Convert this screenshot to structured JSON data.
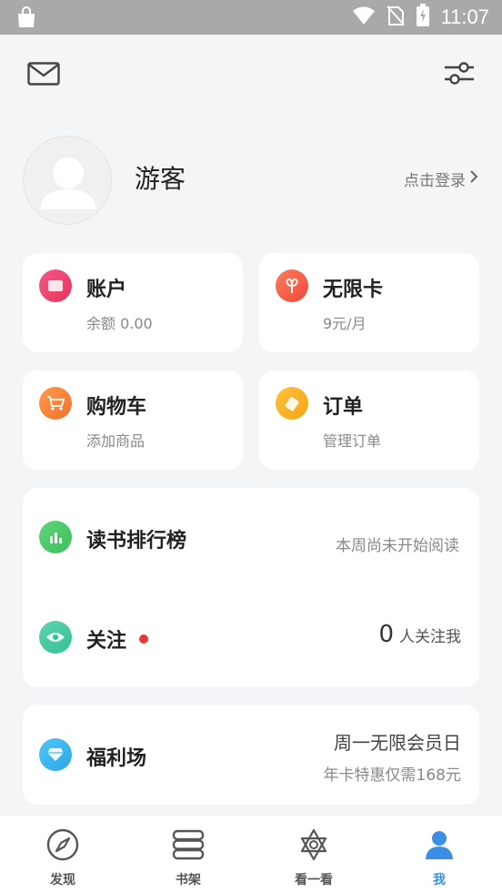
{
  "status_bar": {
    "time": "11:07"
  },
  "profile": {
    "username": "游客",
    "login_label": "点击登录"
  },
  "cards": {
    "account": {
      "title": "账户",
      "subtitle": "余额 0.00"
    },
    "unlimited": {
      "title": "无限卡",
      "subtitle": "9元/月"
    },
    "cart": {
      "title": "购物车",
      "subtitle": "添加商品"
    },
    "orders": {
      "title": "订单",
      "subtitle": "管理订单"
    }
  },
  "reading_rank": {
    "title": "读书排行榜",
    "status": "本周尚未开始阅读"
  },
  "follow": {
    "title": "关注",
    "count": "0",
    "count_label": "人关注我"
  },
  "welfare": {
    "title": "福利场",
    "line1": "周一无限会员日",
    "line2": "年卡特惠仅需168元"
  },
  "tabs": [
    {
      "label": "发现",
      "icon": "compass-icon"
    },
    {
      "label": "书架",
      "icon": "bookshelf-icon"
    },
    {
      "label": "看一看",
      "icon": "star-of-david-icon"
    },
    {
      "label": "我",
      "icon": "person-icon"
    }
  ],
  "colors": {
    "accent": "#3a8ee6",
    "background": "#f4f5f7",
    "dot": "#e53935"
  }
}
